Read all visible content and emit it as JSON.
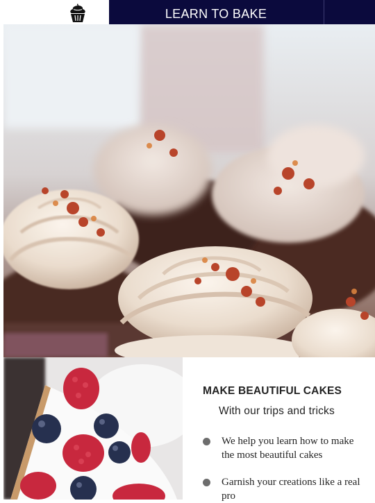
{
  "header": {
    "logo_icon": "cupcake-icon",
    "title": "LEARN TO BAKE",
    "bg_color": "#0b0a3d"
  },
  "hero": {
    "image": "cupcakes-with-frosting-photo"
  },
  "section": {
    "image": "berry-cheesecake-slice-photo",
    "heading": "MAKE BEAUTIFUL CAKES",
    "subheading": "With our trips and tricks",
    "features": [
      {
        "icon": "bullet-dot",
        "text": "We help you learn how to make the most beautiful cakes"
      },
      {
        "icon": "bullet-dot",
        "text": "Garnish your creations like a real pro"
      }
    ]
  }
}
